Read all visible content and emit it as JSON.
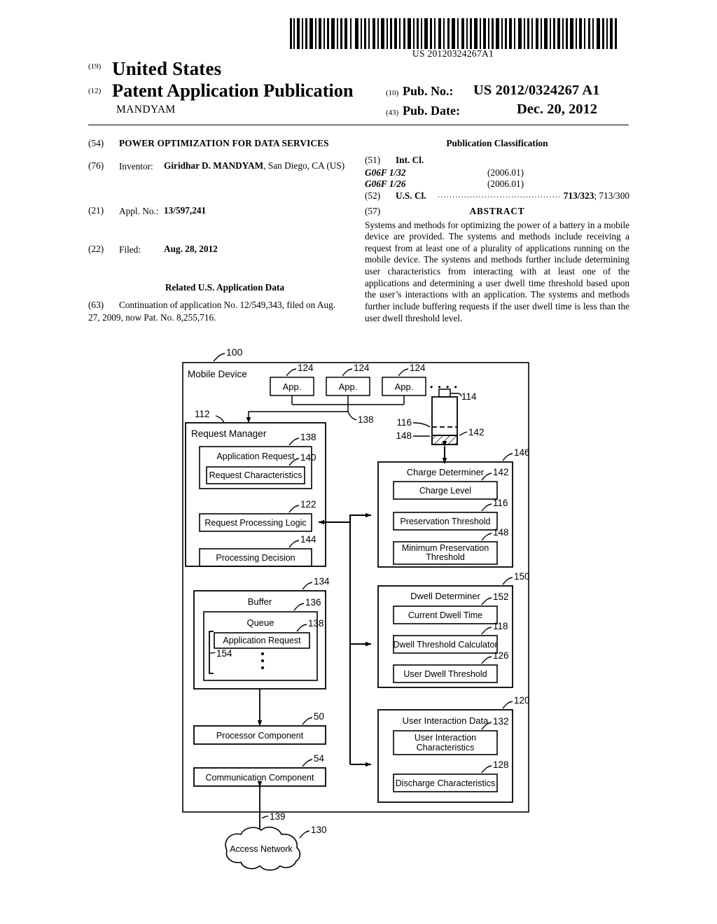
{
  "header": {
    "barcode_number": "US 20120324267A1",
    "kind_19": "(19)",
    "country": "United States",
    "kind_12": "(12)",
    "doc_type": "Patent Application Publication",
    "applicant_surname": "MANDYAM",
    "kind_10": "(10)",
    "pub_no_label": "Pub. No.:",
    "pub_no_value": "US 2012/0324267 A1",
    "kind_43": "(43)",
    "pub_date_label": "Pub. Date:",
    "pub_date_value": "Dec. 20, 2012"
  },
  "left_column": {
    "title_num": "(54)",
    "title": "POWER OPTIMIZATION FOR DATA SERVICES",
    "inventor_num": "(76)",
    "inventor_label": "Inventor:",
    "inventor_name": "Giridhar D. MANDYAM",
    "inventor_rest": ", San Diego, CA (US)",
    "appl_num": "(21)",
    "appl_label": "Appl. No.:",
    "appl_value": "13/597,241",
    "filed_num": "(22)",
    "filed_label": "Filed:",
    "filed_value": "Aug. 28, 2012",
    "related_heading": "Related U.S. Application Data",
    "related_num": "(63)",
    "related_text": "Continuation of application No. 12/549,343, filed on Aug. 27, 2009, now Pat. No. 8,255,716."
  },
  "right_column": {
    "pub_class_heading": "Publication Classification",
    "intcl_num": "(51)",
    "intcl_label": "Int. Cl.",
    "intcl_entries": [
      {
        "code": "G06F 1/32",
        "version": "(2006.01)"
      },
      {
        "code": "G06F 1/26",
        "version": "(2006.01)"
      }
    ],
    "uscl_num": "(52)",
    "uscl_label": "U.S. Cl.",
    "uscl_leader": "..........................................",
    "uscl_primary": "713/323",
    "uscl_secondary": "; 713/300",
    "abstract_num": "(57)",
    "abstract_label": "ABSTRACT",
    "abstract_text": "Systems and methods for optimizing the power of a battery in a mobile device are provided. The systems and methods include receiving a request from at least one of a plurality of applications running on the mobile device. The systems and methods further include determining user characteristics from interacting with at least one of the applications and determining a user dwell time threshold based upon the user’s interactions with an application. The systems and methods further include buffering requests if the user dwell time is less than the user dwell threshold level."
  },
  "figure": {
    "mobile_device_label": "Mobile Device",
    "mobile_device_ref": "100",
    "apps": [
      {
        "label": "App.",
        "ref": "124"
      },
      {
        "label": "App.",
        "ref": "124"
      },
      {
        "label": "App.",
        "ref": "124"
      }
    ],
    "app_ellipsis": "•  •  •  •",
    "app_link_ref": "138",
    "battery": {
      "terminal_ref": "114",
      "preservation_ref": "116",
      "min_preservation_ref": "148",
      "charge_ref": "142"
    },
    "request_manager": {
      "label": "Request Manager",
      "ref": "112",
      "children": [
        {
          "label": "Application Request",
          "ref": "138",
          "children": [
            {
              "label": "Request  Characteristics",
              "ref": "140"
            }
          ]
        },
        {
          "label": "Request Processing Logic",
          "ref": "122"
        },
        {
          "label": "Processing Decision",
          "ref": "144"
        }
      ]
    },
    "charge_determiner": {
      "label": "Charge Determiner",
      "ref": "146",
      "children": [
        {
          "label": "Charge Level",
          "ref": "142"
        },
        {
          "label": "Preservation Threshold",
          "ref": "116"
        },
        {
          "label": "Minimum Preservation Threshold",
          "ref": "148"
        }
      ]
    },
    "buffer": {
      "label": "Buffer",
      "ref": "134",
      "queue_label": "Queue",
      "queue_ref": "136",
      "queue_item_label": "Application Request",
      "queue_item_ref": "138",
      "queue_bracket_ref": "154",
      "queue_vdots": "⋮"
    },
    "dwell_determiner": {
      "label": "Dwell Determiner",
      "ref": "150",
      "children": [
        {
          "label": "Current Dwell Time",
          "ref": "152"
        },
        {
          "label": "Dwell Threshold Calculator",
          "ref": "118"
        },
        {
          "label": "User Dwell Threshold",
          "ref": "126"
        }
      ]
    },
    "user_interaction_data": {
      "label": "User Interaction Data",
      "ref": "120",
      "children": [
        {
          "label": "User Interaction Characteristics",
          "ref": "132"
        },
        {
          "label": "Discharge Characteristics",
          "ref": "128"
        }
      ]
    },
    "processor_component": {
      "label": "Processor Component",
      "ref": "50"
    },
    "communication_component": {
      "label": "Communication Component",
      "ref": "54"
    },
    "network_link_ref": "139",
    "access_network": {
      "label": "Access Network",
      "ref": "130"
    }
  }
}
